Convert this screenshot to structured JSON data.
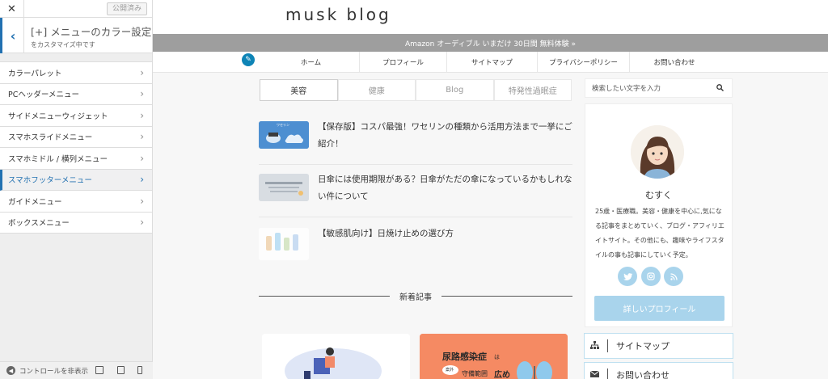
{
  "customizer": {
    "close_glyph": "✕",
    "publish_label": "公開済み",
    "back_glyph": "‹",
    "section_title": "[+] メニューのカラー設定",
    "section_sub": "をカスタマイズ中です",
    "items": [
      {
        "label": "カラーパレット"
      },
      {
        "label": "PCヘッダーメニュー"
      },
      {
        "label": "サイドメニューウィジェット"
      },
      {
        "label": "スマホスライドメニュー"
      },
      {
        "label": "スマホミドル / 横列メニュー"
      },
      {
        "label": "スマホフッターメニュー"
      },
      {
        "label": "ガイドメニュー"
      },
      {
        "label": "ボックスメニュー"
      }
    ],
    "active_item": "スマホフッターメニュー",
    "footer_label": "コントロールを非表示",
    "accent_color": "#2271b1"
  },
  "site": {
    "logo": "musk blog",
    "notice": "Amazon オーディブル いまだけ 30日間 無料体験 »",
    "nav": [
      "ホーム",
      "プロフィール",
      "サイトマップ",
      "プライバシーポリシー",
      "お問い合わせ"
    ],
    "tabs": [
      "美容",
      "健康",
      "Blog",
      "特発性過眠症"
    ],
    "active_tab": "美容",
    "posts": [
      {
        "title": "【保存版】コスパ最強！ワセリンの種類から活用方法まで一挙にご紹介！",
        "thumb_caption": "ワセリン"
      },
      {
        "title": "日傘には使用期限がある？日傘がただの傘になっているかもしれない件について"
      },
      {
        "title": "【敏感肌向け】日焼け止めの選び方"
      }
    ],
    "new_posts_heading": "新着記事",
    "card2_text": {
      "line1": "尿路感染症",
      "suffix": "は",
      "bubble": "案外",
      "line2": "守備範囲",
      "wide": "広め"
    }
  },
  "sidebar": {
    "search_placeholder": "検索したい文字を入力",
    "profile_name": "むすく",
    "profile_desc": "25歳・医療職。美容・健康を中心に,気になる記事をまとめていく、ブログ・アフィリエイトサイト。その他にも、趣味やライフスタイルの事も記事にしていく予定。",
    "social": [
      "twitter",
      "instagram",
      "rss"
    ],
    "profile_button": "詳しいプロフィール",
    "links": [
      {
        "label": "サイトマップ",
        "icon": "sitemap-icon"
      },
      {
        "label": "お問い合わせ",
        "icon": "mail-icon"
      }
    ],
    "social_color": "#a9d4ec"
  }
}
